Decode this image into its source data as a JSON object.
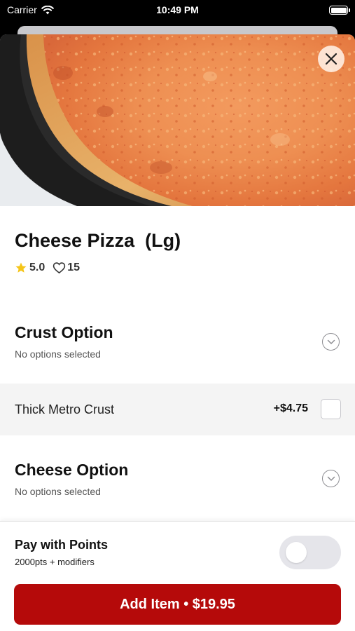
{
  "status_bar": {
    "carrier": "Carrier",
    "time": "10:49 PM"
  },
  "product": {
    "name": "Cheese Pizza  (Lg)",
    "rating": "5.0",
    "likes": "15"
  },
  "options": [
    {
      "title": "Crust Option",
      "subtitle": "No options selected"
    },
    {
      "title": "Cheese Option",
      "subtitle": "No options selected"
    }
  ],
  "crust_choice": {
    "label": "Thick Metro Crust",
    "price": "+$4.75",
    "checked": false
  },
  "points": {
    "title": "Pay with Points",
    "subtitle": "2000pts + modifiers",
    "enabled": false
  },
  "cta": {
    "label": "Add Item • $19.95"
  },
  "icons": {
    "close": "close-icon",
    "star": "star-icon",
    "heart": "heart-icon",
    "chevron": "chevron-down-icon",
    "wifi": "wifi-icon",
    "battery": "battery-icon"
  },
  "colors": {
    "accent": "#b50a0a",
    "star": "#f5c518",
    "row_background": "#f4f4f4",
    "toggle_off": "#e5e5ea"
  }
}
